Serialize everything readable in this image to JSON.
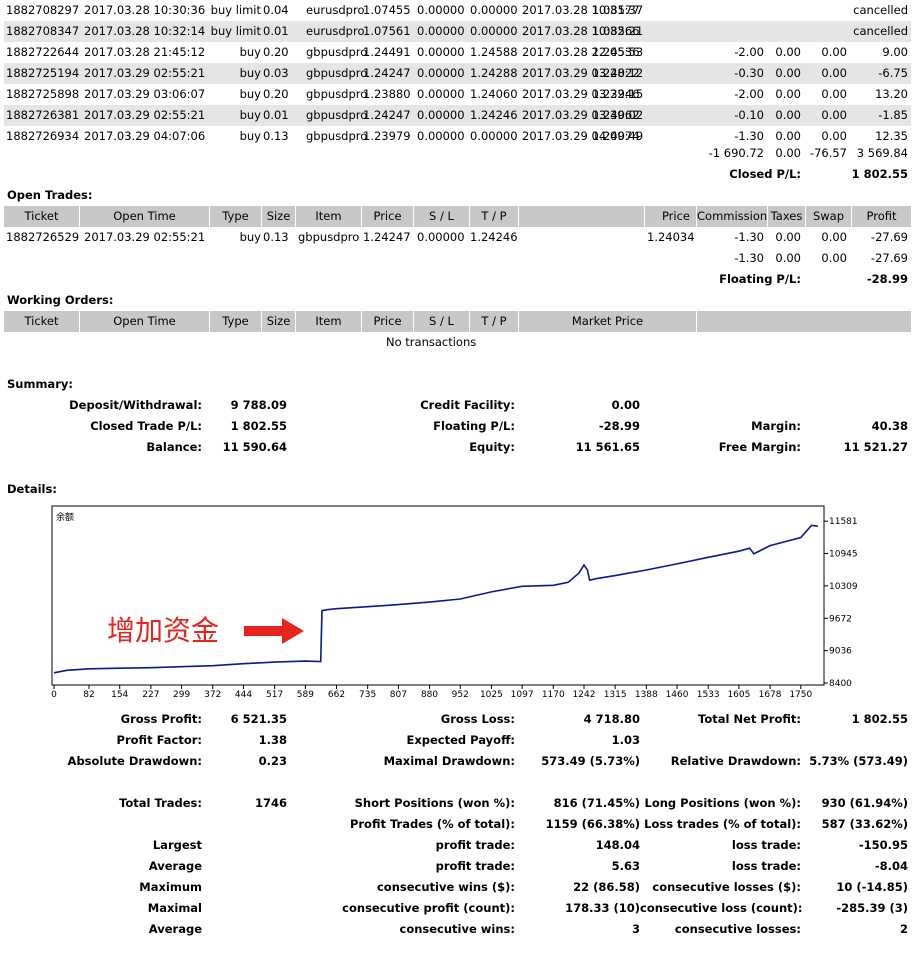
{
  "closed_rows": [
    {
      "ticket": "1882708297",
      "open_time": "2017.03.28 10:30:36",
      "type": "buy limit",
      "size": "0.04",
      "item": "eurusdpro",
      "price": "1.07455",
      "sl": "0.00000",
      "tp": "0.00000",
      "close_time": "2017.03.28 10:31:37",
      "close_price": "1.08577",
      "commission": "",
      "taxes": "",
      "swap": "",
      "profit": "cancelled"
    },
    {
      "ticket": "1882708347",
      "open_time": "2017.03.28 10:32:14",
      "type": "buy limit",
      "size": "0.01",
      "item": "eurusdpro",
      "price": "1.07561",
      "sl": "0.00000",
      "tp": "0.00000",
      "close_time": "2017.03.28 10:32:21",
      "close_price": "1.08566",
      "commission": "",
      "taxes": "",
      "swap": "",
      "profit": "cancelled"
    },
    {
      "ticket": "1882722644",
      "open_time": "2017.03.28 21:45:12",
      "type": "buy",
      "size": "0.20",
      "item": "gbpusdpro",
      "price": "1.24491",
      "sl": "0.00000",
      "tp": "1.24588",
      "close_time": "2017.03.28 22:05:53",
      "close_price": "1.24536",
      "commission": "-2.00",
      "taxes": "0.00",
      "swap": "0.00",
      "profit": "9.00"
    },
    {
      "ticket": "1882725194",
      "open_time": "2017.03.29 02:55:21",
      "type": "buy",
      "size": "0.03",
      "item": "gbpusdpro",
      "price": "1.24247",
      "sl": "0.00000",
      "tp": "1.24288",
      "close_time": "2017.03.29 03:28:12",
      "close_price": "1.24022",
      "commission": "-0.30",
      "taxes": "0.00",
      "swap": "0.00",
      "profit": "-6.75"
    },
    {
      "ticket": "1882725898",
      "open_time": "2017.03.29 03:06:07",
      "type": "buy",
      "size": "0.20",
      "item": "gbpusdpro",
      "price": "1.23880",
      "sl": "0.00000",
      "tp": "1.24060",
      "close_time": "2017.03.29 03:22:15",
      "close_price": "1.23946",
      "commission": "-2.00",
      "taxes": "0.00",
      "swap": "0.00",
      "profit": "13.20"
    },
    {
      "ticket": "1882726381",
      "open_time": "2017.03.29 02:55:21",
      "type": "buy",
      "size": "0.01",
      "item": "gbpusdpro",
      "price": "1.24247",
      "sl": "0.00000",
      "tp": "1.24246",
      "close_time": "2017.03.29 03:39:02",
      "close_price": "1.24062",
      "commission": "-0.10",
      "taxes": "0.00",
      "swap": "0.00",
      "profit": "-1.85"
    },
    {
      "ticket": "1882726934",
      "open_time": "2017.03.29 04:07:06",
      "type": "buy",
      "size": "0.13",
      "item": "gbpusdpro",
      "price": "1.23979",
      "sl": "0.00000",
      "tp": "0.00000",
      "close_time": "2017.03.29 04:09:49",
      "close_price": "1.24074",
      "commission": "-1.30",
      "taxes": "0.00",
      "swap": "0.00",
      "profit": "12.35"
    }
  ],
  "closed_totals": {
    "commission": "-1 690.72",
    "taxes": "0.00",
    "swap": "-76.57",
    "profit": "3 569.84"
  },
  "closed_pl": {
    "label": "Closed P/L:",
    "value": "1 802.55"
  },
  "open_trades": {
    "title": "Open Trades:",
    "headers": [
      "Ticket",
      "Open Time",
      "Type",
      "Size",
      "Item",
      "Price",
      "S / L",
      "T / P",
      "",
      "Price",
      "Commission",
      "Taxes",
      "Swap",
      "Profit"
    ],
    "rows": [
      {
        "ticket": "1882726529",
        "open_time": "2017.03.29 02:55:21",
        "type": "buy",
        "size": "0.13",
        "item": "gbpusdpro",
        "price": "1.24247",
        "sl": "0.00000",
        "tp": "1.24246",
        "market_price": "1.24034",
        "commission": "-1.30",
        "taxes": "0.00",
        "swap": "0.00",
        "profit": "-27.69"
      }
    ],
    "totals": {
      "commission": "-1.30",
      "taxes": "0.00",
      "swap": "0.00",
      "profit": "-27.69"
    },
    "floating_label": "Floating P/L:",
    "floating_value": "-28.99"
  },
  "working_orders": {
    "title": "Working Orders:",
    "headers": [
      "Ticket",
      "Open Time",
      "Type",
      "Size",
      "Item",
      "Price",
      "S / L",
      "T / P",
      "Market Price",
      ""
    ],
    "empty": "No transactions"
  },
  "summary": {
    "title": "Summary:",
    "deposit_label": "Deposit/Withdrawal:",
    "deposit": "9 788.09",
    "credit_label": "Credit Facility:",
    "credit": "0.00",
    "closed_label": "Closed Trade P/L:",
    "closed": "1 802.55",
    "floating_label": "Floating P/L:",
    "floating": "-28.99",
    "margin_label": "Margin:",
    "margin": "40.38",
    "balance_label": "Balance:",
    "balance": "11 590.64",
    "equity_label": "Equity:",
    "equity": "11 561.65",
    "free_margin_label": "Free Margin:",
    "free_margin": "11 521.27"
  },
  "details_title": "Details:",
  "annotation": "增加资金",
  "chart_data": {
    "type": "line",
    "title": "余额",
    "x_ticks": [
      "0",
      "82",
      "154",
      "227",
      "299",
      "372",
      "444",
      "517",
      "589",
      "662",
      "735",
      "807",
      "880",
      "952",
      "1025",
      "1097",
      "1170",
      "1242",
      "1315",
      "1388",
      "1460",
      "1533",
      "1605",
      "1678",
      "1750"
    ],
    "y_ticks": [
      "11581",
      "10945",
      "10309",
      "9672",
      "9036",
      "8400"
    ],
    "xlim": [
      0,
      1795
    ],
    "ylim": [
      8400,
      11800
    ],
    "color": "#0a1a8c",
    "series": [
      {
        "x": [
          0,
          30,
          82,
          154,
          227,
          299,
          372,
          444,
          517,
          589,
          625,
          628,
          640,
          662,
          735,
          807,
          880,
          952,
          1025,
          1097,
          1170,
          1205,
          1230,
          1242,
          1250,
          1255,
          1270,
          1315,
          1388,
          1460,
          1533,
          1605,
          1630,
          1640,
          1678,
          1750,
          1775,
          1790
        ],
        "y": [
          8600,
          8650,
          8680,
          8690,
          8700,
          8720,
          8740,
          8780,
          8810,
          8830,
          8820,
          9820,
          9840,
          9860,
          9900,
          9940,
          9990,
          10050,
          10190,
          10300,
          10320,
          10380,
          10560,
          10720,
          10620,
          10420,
          10450,
          10510,
          10620,
          10740,
          10870,
          10990,
          11050,
          10940,
          11100,
          11260,
          11500,
          11480
        ]
      }
    ]
  },
  "stats": {
    "gross_profit_label": "Gross Profit:",
    "gross_profit": "6 521.35",
    "gross_loss_label": "Gross Loss:",
    "gross_loss": "4 718.80",
    "total_net_label": "Total Net Profit:",
    "total_net": "1 802.55",
    "profit_factor_label": "Profit Factor:",
    "profit_factor": "1.38",
    "expected_payoff_label": "Expected Payoff:",
    "expected_payoff": "1.03",
    "abs_dd_label": "Absolute Drawdown:",
    "abs_dd": "0.23",
    "max_dd_label": "Maximal Drawdown:",
    "max_dd": "573.49 (5.73%)",
    "rel_dd_label": "Relative Drawdown:",
    "rel_dd": "5.73% (573.49)",
    "total_trades_label": "Total Trades:",
    "total_trades": "1746",
    "short_label": "Short Positions (won %):",
    "short": "816 (71.45%)",
    "long_label": "Long Positions (won %):",
    "long": "930 (61.94%)",
    "profit_trades_label": "Profit Trades (% of total):",
    "profit_trades": "1159 (66.38%)",
    "loss_trades_label": "Loss trades (% of total):",
    "loss_trades": "587 (33.62%)",
    "largest_label": "Largest",
    "largest_profit_label": "profit trade:",
    "largest_profit": "148.04",
    "largest_loss_label": "loss trade:",
    "largest_loss": "-150.95",
    "average_label": "Average",
    "average_profit_label": "profit trade:",
    "average_profit": "5.63",
    "average_loss_label": "loss trade:",
    "average_loss": "-8.04",
    "maximum_label": "Maximum",
    "cons_wins_label": "consecutive wins ($):",
    "cons_wins": "22 (86.58)",
    "cons_losses_label": "consecutive losses ($):",
    "cons_losses": "10 (-14.85)",
    "maximal_label": "Maximal",
    "cons_profit_label": "consecutive profit (count):",
    "cons_profit": "178.33 (10)",
    "cons_loss_label": "consecutive loss (count):",
    "cons_loss": "-285.39 (3)",
    "average2_label": "Average",
    "avg_cons_wins_label": "consecutive wins:",
    "avg_cons_wins": "3",
    "avg_cons_losses_label": "consecutive losses:",
    "avg_cons_losses": "2"
  }
}
